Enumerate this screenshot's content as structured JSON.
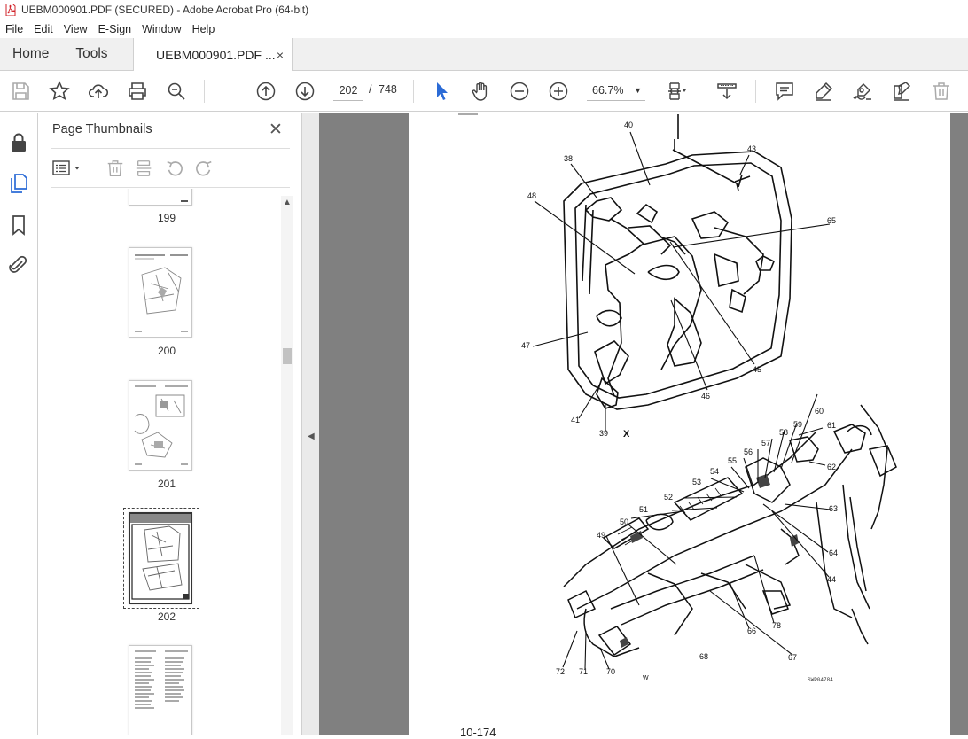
{
  "window": {
    "title": "UEBM000901.PDF (SECURED) - Adobe Acrobat Pro (64-bit)"
  },
  "menu": [
    "File",
    "Edit",
    "View",
    "E-Sign",
    "Window",
    "Help"
  ],
  "tabs": {
    "home": "Home",
    "tools": "Tools",
    "document": "UEBM000901.PDF ...",
    "close": "×"
  },
  "toolbar": {
    "current_page": "202",
    "separator": "/",
    "total_pages": "748",
    "zoom": "66.7%"
  },
  "thumbnails_panel": {
    "title": "Page Thumbnails",
    "close": "✕",
    "pages": [
      {
        "label": "199"
      },
      {
        "label": "200"
      },
      {
        "label": "201"
      },
      {
        "label": "202",
        "selected": true
      },
      {
        "label": ""
      }
    ]
  },
  "document": {
    "footer": "10-174",
    "view_marker_top": "X",
    "view_marker_bottom": "W",
    "figure_code": "SWP04784",
    "callouts_top": [
      "40",
      "38",
      "43",
      "48",
      "65",
      "47",
      "45",
      "46",
      "41",
      "39"
    ],
    "callouts_bottom": [
      "61",
      "60",
      "59",
      "58",
      "57",
      "56",
      "55",
      "54",
      "53",
      "52",
      "62",
      "51",
      "63",
      "50",
      "49",
      "64",
      "44",
      "78",
      "66",
      "67",
      "68",
      "72",
      "71",
      "70"
    ]
  },
  "colors": {
    "accent_blue": "#2b6bd6",
    "pdf_icon_red": "#d2232a",
    "viewer_gray": "#808080"
  }
}
